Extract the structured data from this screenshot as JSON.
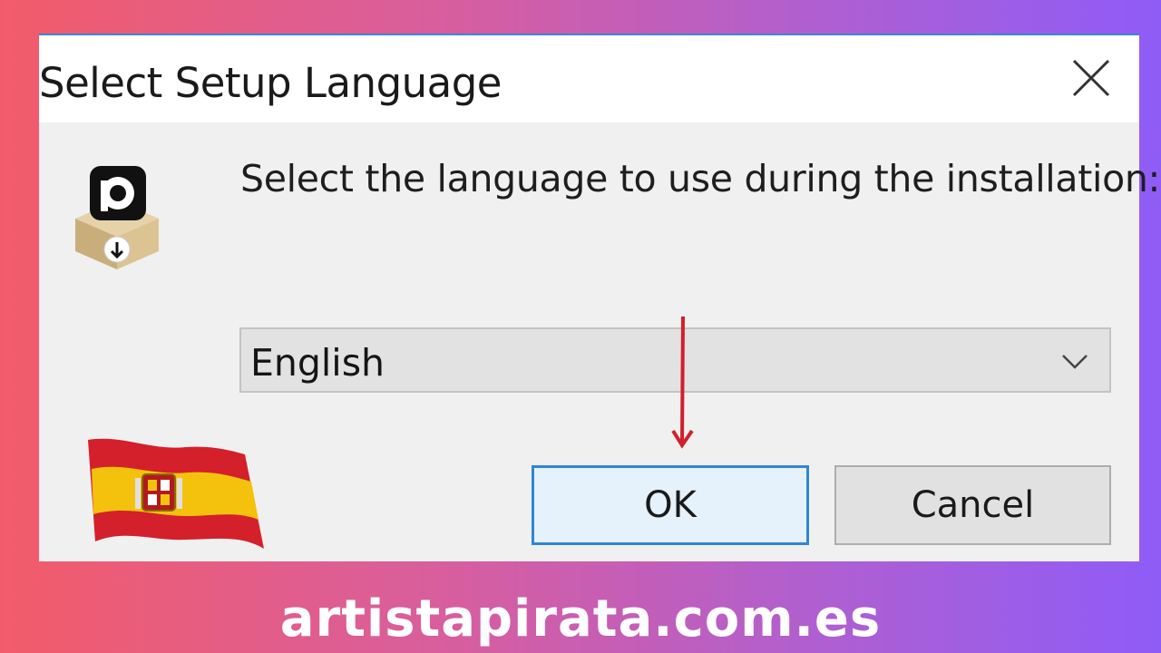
{
  "dialog": {
    "title": "Select Setup Language",
    "prompt": "Select the language to use during the installation:",
    "language_select": {
      "selected": "English"
    },
    "ok_label": "OK",
    "cancel_label": "Cancel"
  },
  "icons": {
    "close": "close-icon",
    "app": "installer-box-icon",
    "dropdown": "chevron-down-icon",
    "annotation": "red-arrow-down-icon",
    "flag": "spain-flag-icon"
  },
  "watermark": "artistapirata.com.es",
  "colors": {
    "accent_blue": "#2f86d6",
    "ok_background": "#e5f1fb",
    "arrow_red": "#d0202a",
    "flag_red": "#d3202b",
    "flag_yellow": "#f4c20d"
  }
}
